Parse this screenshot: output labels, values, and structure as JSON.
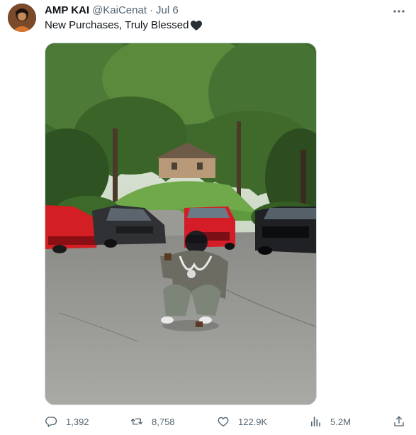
{
  "tweet": {
    "author": {
      "display_name": "AMP KAI",
      "handle": "@KaiCenat",
      "avatar_icon": "profile-avatar"
    },
    "separator": "·",
    "date": "Jul 6",
    "text": "New Purchases, Truly Blessed",
    "text_emoji": "black-heart-icon",
    "more_icon": "more-horizontal-icon",
    "media_description_icon": "photo"
  },
  "actions": {
    "reply": {
      "icon": "reply-icon",
      "count": "1,392"
    },
    "retweet": {
      "icon": "retweet-icon",
      "count": "8,758"
    },
    "like": {
      "icon": "heart-icon",
      "count": "122.9K"
    },
    "views": {
      "icon": "views-icon",
      "count": "5.2M"
    },
    "share": {
      "icon": "share-icon"
    }
  },
  "colors": {
    "text_primary": "#0f1419",
    "text_secondary": "#536471",
    "border": "#cfd9de"
  }
}
